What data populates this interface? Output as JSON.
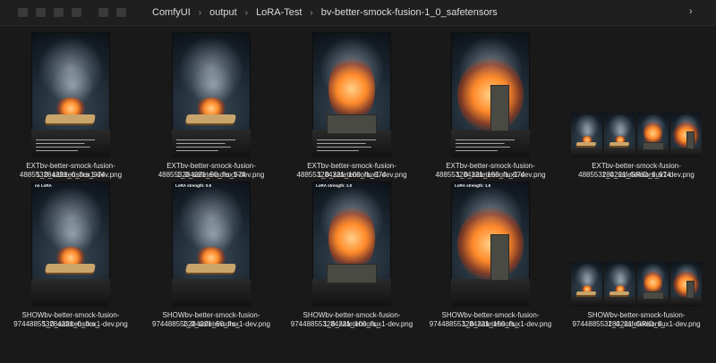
{
  "breadcrumb": [
    "ComfyUI",
    "output",
    "LoRA-Test",
    "bv-better-smock-fusion-1_0_safetensors"
  ],
  "row1": [
    {
      "label1": "EXTbv-better-smock-fusion-1_0_safetensors_974",
      "label2": "488553284221_0_flux1-dev.png",
      "variant": "book"
    },
    {
      "label1": "EXTbv-better-smock-fusion-1_0_safetensors_974",
      "label2": "488553284221_50_flux1-dev.png",
      "variant": "book"
    },
    {
      "label1": "EXTbv-better-smock-fusion-1_0_safetensors_974",
      "label2": "488553284221_100_flux1-dev.png",
      "variant": "block"
    },
    {
      "label1": "EXTbv-better-smock-fusion-1_0_safetensors_974",
      "label2": "488553284221_150_flux1-dev.png",
      "variant": "tower"
    },
    {
      "label1": "EXTbv-better-smock-fusion-1_0_safetensors_974",
      "label2": "488553284221_GRID_flux1-dev.png",
      "variant": "grid"
    }
  ],
  "row2": [
    {
      "label1": "SHOWbv-better-smock-fusion-1_0_safetensors_",
      "label2": "974488553284221_0_flux1-dev.png",
      "variant": "book",
      "overlay": "no LoRA"
    },
    {
      "label1": "SHOWbv-better-smock-fusion-1_0_safetensors_",
      "label2": "974488553284221_50_flux1-dev.png",
      "variant": "book",
      "overlay": "LoRA strength: 0.5"
    },
    {
      "label1": "SHOWbv-better-smock-fusion-1_0_safetensors_",
      "label2": "974488553284221_100_flux1-dev.png",
      "variant": "block",
      "overlay": "LoRA strength: 1.0"
    },
    {
      "label1": "SHOWbv-better-smock-fusion-1_0_safetensors_",
      "label2": "974488553284221_150_flux1-dev.png",
      "variant": "tower",
      "overlay": "LoRA strength: 1.5"
    },
    {
      "label1": "SHOWbv-better-smock-fusion-1_0_safetensors_",
      "label2": "974488553284221_GRID_flux1-dev.png",
      "variant": "grid"
    }
  ]
}
